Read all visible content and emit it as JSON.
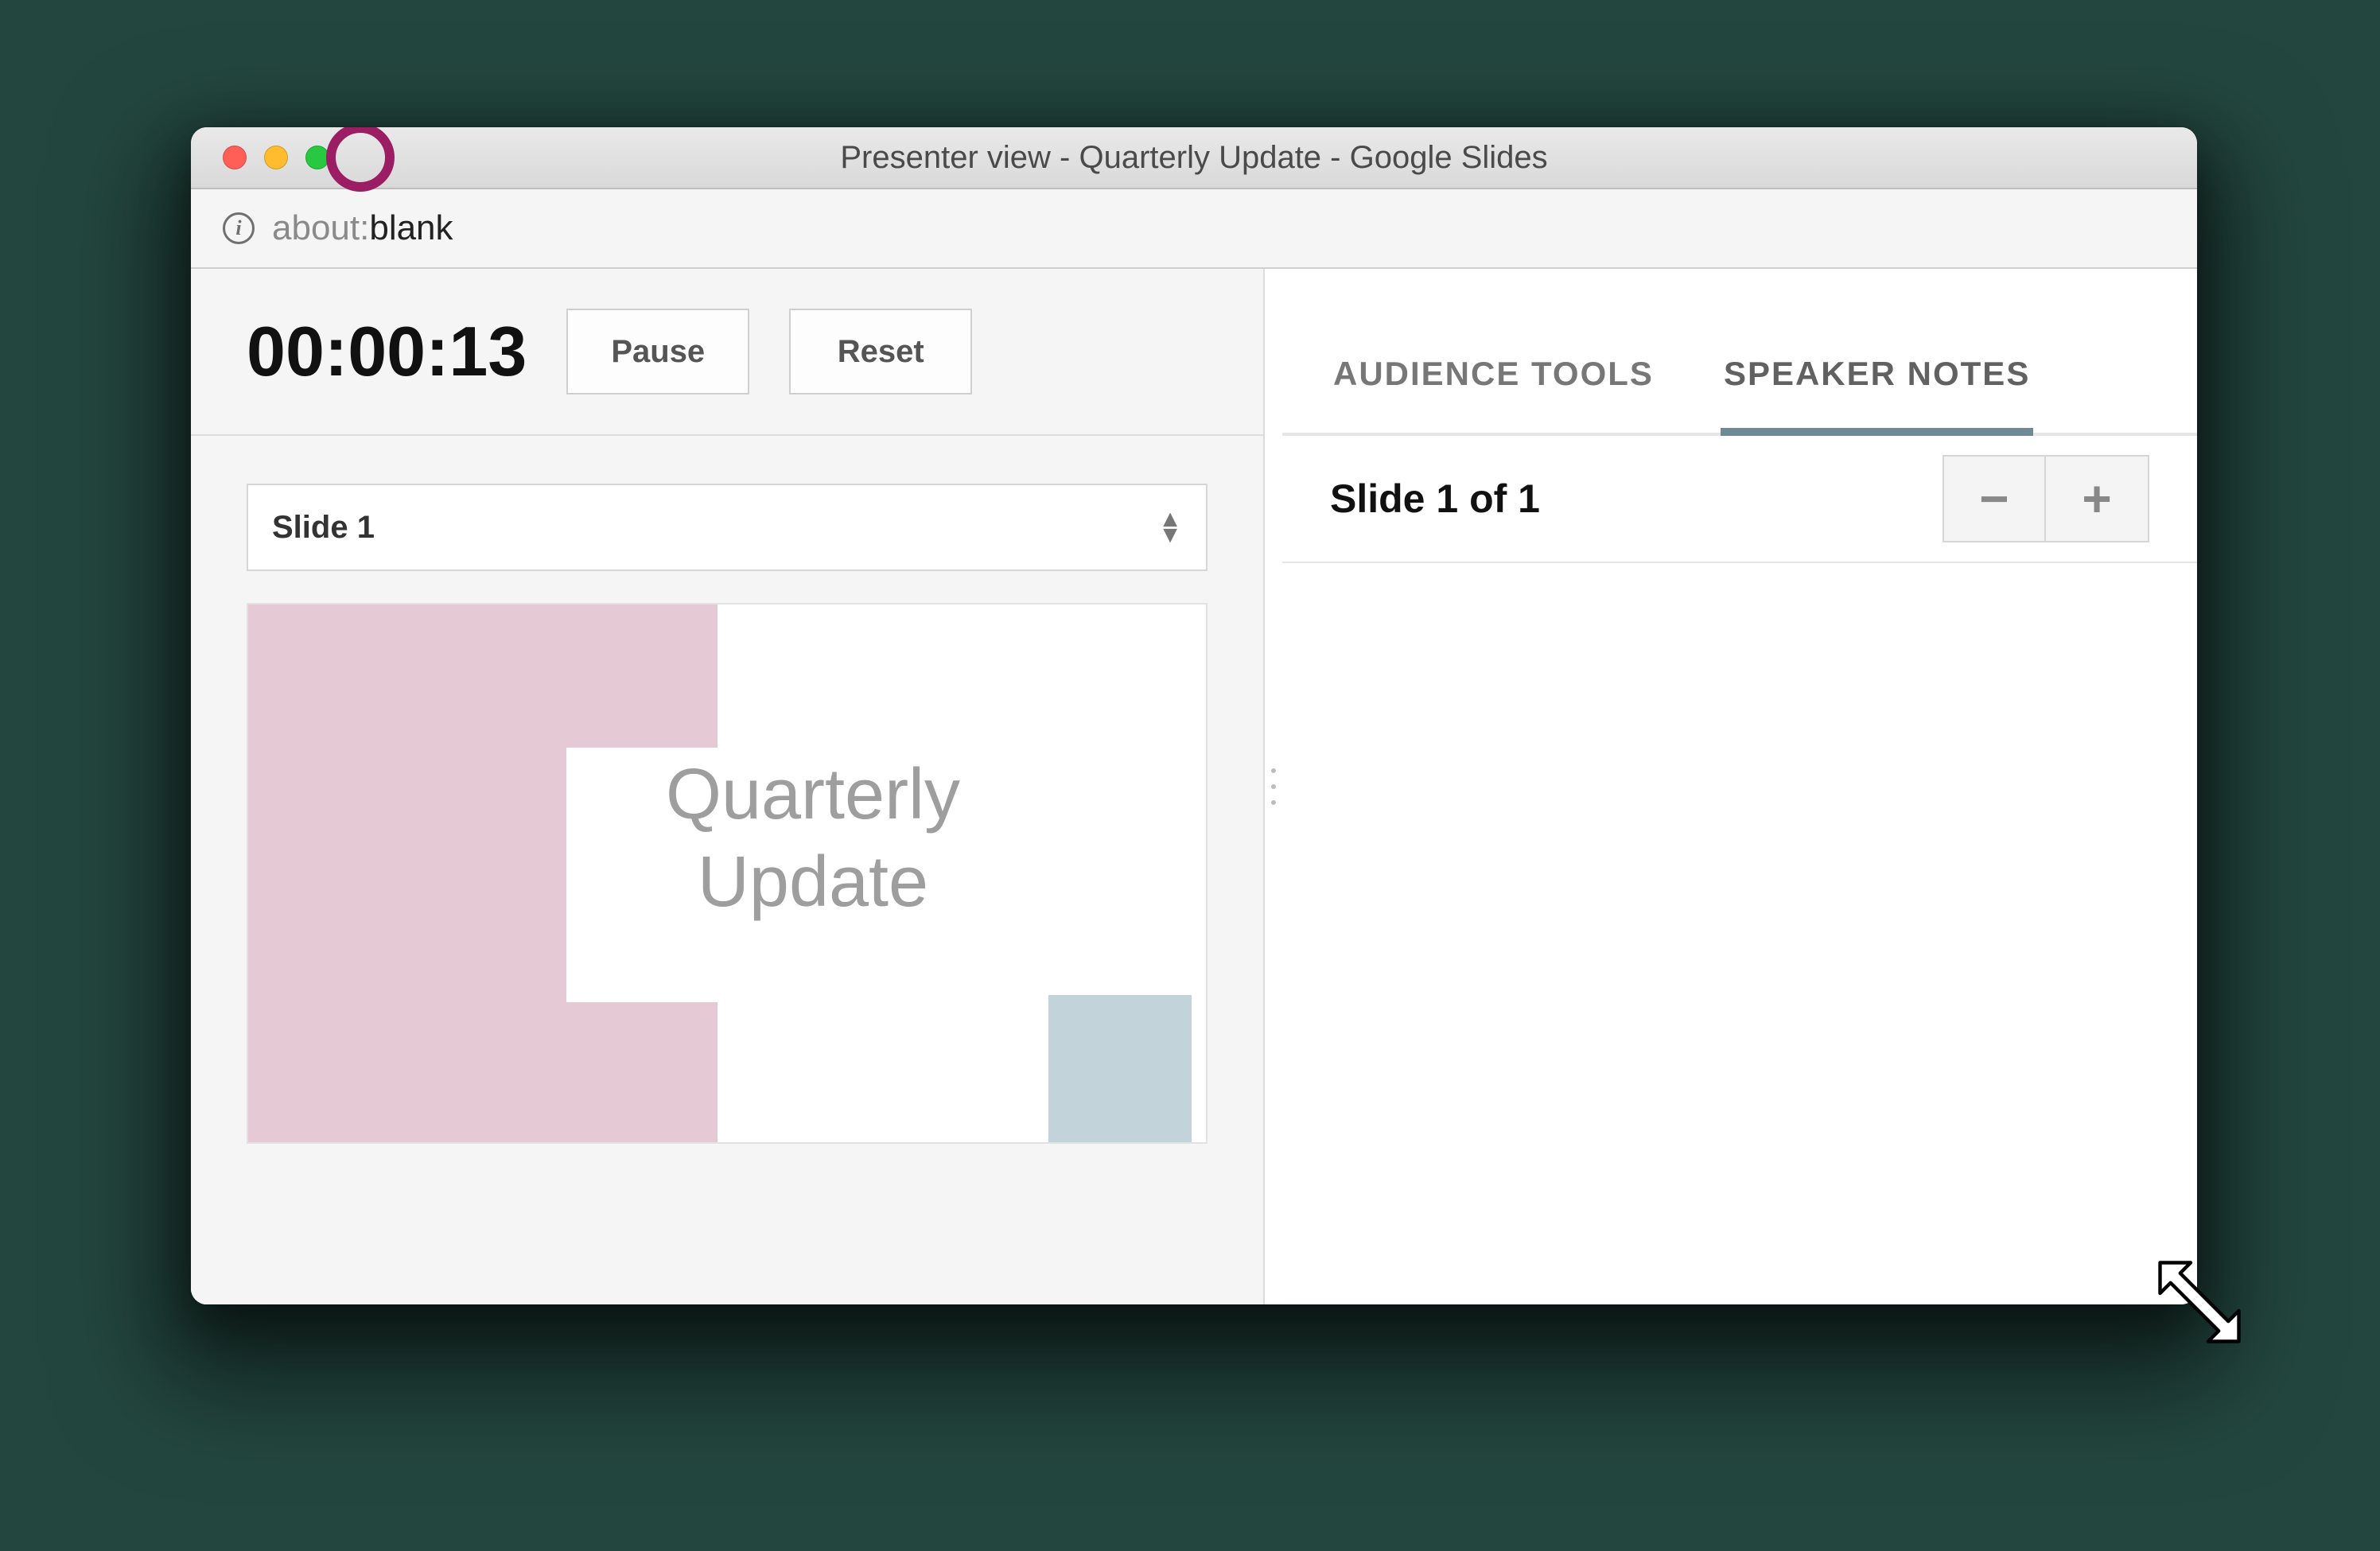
{
  "window": {
    "title": "Presenter view - Quarterly Update - Google Slides"
  },
  "addressbar": {
    "scheme": "about:",
    "path": "blank"
  },
  "timer": {
    "elapsed": "00:00:13",
    "pause_label": "Pause",
    "reset_label": "Reset"
  },
  "slide_selector": {
    "selected": "Slide 1"
  },
  "slide_preview": {
    "title_line1": "Quarterly",
    "title_line2": "Update"
  },
  "tabs": {
    "audience_tools": "AUDIENCE TOOLS",
    "speaker_notes": "SPEAKER NOTES",
    "active": "speaker_notes"
  },
  "notes": {
    "position": "Slide 1 of 1",
    "zoom_out_label": "−",
    "zoom_in_label": "+"
  },
  "annotation": {
    "highlight": "maximize-traffic-light"
  }
}
